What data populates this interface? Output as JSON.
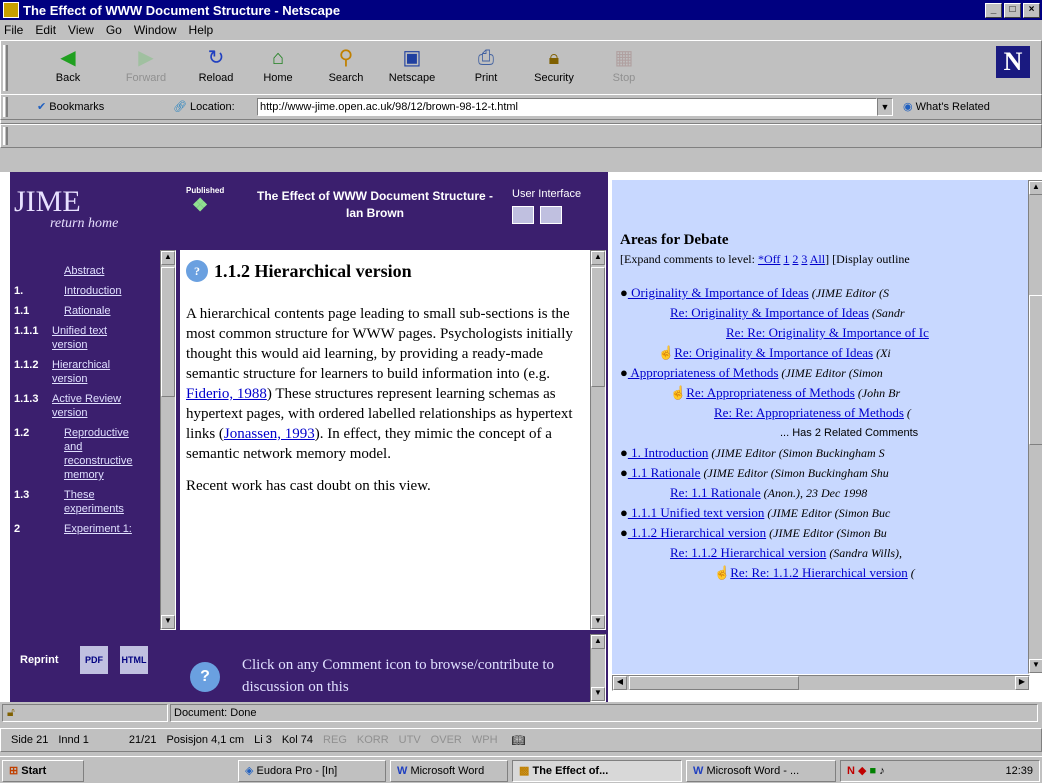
{
  "window": {
    "title": "The Effect of WWW Document Structure - Netscape"
  },
  "menu": [
    "File",
    "Edit",
    "View",
    "Go",
    "Window",
    "Help"
  ],
  "toolbar": {
    "back": "Back",
    "forward": "Forward",
    "reload": "Reload",
    "home": "Home",
    "search": "Search",
    "netscape": "Netscape",
    "print": "Print",
    "security": "Security",
    "stop": "Stop"
  },
  "location": {
    "bookmarks": "Bookmarks",
    "label": "Location:",
    "url": "http://www-jime.open.ac.uk/98/12/brown-98-12-t.html",
    "related": "What's Related"
  },
  "header": {
    "logo": "JIME",
    "return_home": "return home",
    "published": "Published",
    "title": "The Effect of WWW Document Structure - Ian Brown",
    "user_interface": "User Interface"
  },
  "toc": [
    {
      "num": "",
      "label": "Abstract"
    },
    {
      "num": "1.",
      "label": "Introduction"
    },
    {
      "num": "1.1",
      "label": "Rationale"
    },
    {
      "num": "1.1.1",
      "label": "Unified text version"
    },
    {
      "num": "1.1.2",
      "label": "Hierarchical version"
    },
    {
      "num": "1.1.3",
      "label": "Active Review version"
    },
    {
      "num": "1.2",
      "label": "Reproductive and reconstructive memory"
    },
    {
      "num": "1.3",
      "label": "These experiments"
    },
    {
      "num": "2",
      "label": "Experiment 1:"
    }
  ],
  "article": {
    "heading": "1.1.2 Hierarchical version",
    "p1_a": "A hierarchical contents page leading to small sub-sections is the most common structure for WWW pages. Psychologists initially thought this would aid learning, by providing a ready-made semantic structure for learners to build information into (e.g. ",
    "p1_link1": "Fiderio, 1988",
    "p1_b": ") These structures represent learning schemas as hypertext pages, with ordered labelled relationships as hypertext links (",
    "p1_link2": "Jonassen, 1993",
    "p1_c": "). In effect, they mimic the concept of a semantic network memory model.",
    "p2": "Recent work has cast doubt on this view."
  },
  "bottom": {
    "reprint": "Reprint",
    "pdf": "PDF",
    "html": "HTML",
    "comment_text": "Click on any Comment icon to browse/contribute to discussion on this"
  },
  "debate": {
    "title": "Areas for Debate",
    "expand_prefix": "[Expand comments to level: ",
    "levels": [
      "*Off",
      "1",
      "2",
      "3",
      "All"
    ],
    "expand_suffix": "] [Display outline",
    "items": [
      {
        "bullet": true,
        "link": " Originality & Importance of Ideas",
        "meta": " (JIME Editor (S"
      },
      {
        "bullet": false,
        "link": "Re: Originality & Importance of Ideas",
        "meta": " (Sandr"
      },
      {
        "bullet": false,
        "link": "Re: Re: Originality & Importance of Ic",
        "meta": ""
      },
      {
        "bullet": false,
        "link": "Re: Originality & Importance of Ideas",
        "meta": " (Xi"
      },
      {
        "bullet": true,
        "link": " Appropriateness of Methods",
        "meta": " (JIME Editor (Simon"
      },
      {
        "bullet": false,
        "link": "Re: Appropriateness of Methods",
        "meta": " (John Br"
      },
      {
        "bullet": false,
        "link": "Re: Re: Appropriateness of Methods",
        "meta": " ("
      },
      {
        "bullet": false,
        "link": "",
        "meta": "... Has 2 Related Comments"
      },
      {
        "bullet": true,
        "link": " 1. Introduction",
        "meta": " (JIME Editor (Simon Buckingham S"
      },
      {
        "bullet": true,
        "link": " 1.1 Rationale",
        "meta": " (JIME Editor (Simon Buckingham Shu"
      },
      {
        "bullet": false,
        "link": "Re: 1.1 Rationale",
        "meta": " (Anon.), 23 Dec 1998"
      },
      {
        "bullet": true,
        "link": " 1.1.1 Unified text version",
        "meta": " (JIME Editor (Simon Buc"
      },
      {
        "bullet": true,
        "link": " 1.1.2 Hierarchical version",
        "meta": " (JIME Editor (Simon Bu"
      },
      {
        "bullet": false,
        "link": "Re: 1.1.2 Hierarchical version",
        "meta": " (Sandra Wills),"
      },
      {
        "bullet": false,
        "link": "Re: Re: 1.1.2 Hierarchical version",
        "meta": " ("
      }
    ]
  },
  "status": {
    "text": "Document: Done"
  },
  "info": {
    "side": "Side 21",
    "section": "Innd 1",
    "pages": "21/21",
    "position": "Posisjon 4,1 cm",
    "line": "Li 3",
    "col": "Kol 74",
    "modes": [
      "REG",
      "KORR",
      "UTV",
      "OVER",
      "WPH"
    ]
  },
  "taskbar": {
    "start": "Start",
    "tasks": [
      "Eudora Pro - [In]",
      "Microsoft Word",
      "The Effect of...",
      "Microsoft Word - ..."
    ],
    "clock": "12:39"
  }
}
